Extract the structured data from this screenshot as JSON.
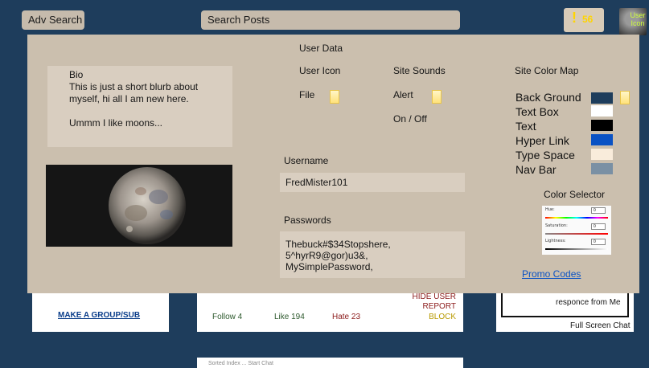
{
  "nav": {
    "adv_search": "Adv Search",
    "search_posts": "Search Posts",
    "alert_mark": "!",
    "alert_count": "56",
    "avatar_text_1": "User",
    "avatar_text_2": "Icon"
  },
  "background": {
    "make_group": "MAKE A GROUP/SUB",
    "follow": "Follow 4",
    "like": "Like 194",
    "hate": "Hate 23",
    "hide_user": "HIDE USER",
    "report": "REPORT",
    "block": "BLOCK",
    "chat_text": "responce from Me",
    "full_screen_chat": "Full Screen Chat",
    "bottom_card_text": "Sorted Index ... Start Chat"
  },
  "panel": {
    "user_data": "User Data",
    "user_icon": "User Icon",
    "file": "File",
    "site_sounds": "Site Sounds",
    "alert": "Alert",
    "on_off": "On / Off",
    "bio": {
      "title": "Bio",
      "line1": "This is just a short blurb about",
      "line2": "myself, hi all I am new here.",
      "line3": "Ummm I like moons..."
    },
    "username_label": "Username",
    "username_value": "FredMister101",
    "passwords_label": "Passwords",
    "passwords": [
      "Thebuck#$34Stopshere,",
      "5^hyrR9@gor)u3&,",
      "MySimplePassword,"
    ],
    "site_color_map": "Site Color Map",
    "colors": [
      {
        "label": "Back Ground",
        "hex": "#1e3d5c"
      },
      {
        "label": "Text Box",
        "hex": "#ffffff"
      },
      {
        "label": "Text",
        "hex": "#000000"
      },
      {
        "label": "Hyper Link",
        "hex": "#0a52c4"
      },
      {
        "label": "Type Space",
        "hex": "#f9ecdb"
      },
      {
        "label": "Nav Bar",
        "hex": "#7a90a4"
      }
    ],
    "color_selector": {
      "title": "Color Selector",
      "hue": "Hue:",
      "saturation": "Saturation:",
      "lightness": "Lightness:",
      "hue_val": "0",
      "sat_val": "0",
      "light_val": "0"
    },
    "promo_codes": "Promo Codes"
  },
  "icons": {
    "file_icon": "file-icon",
    "avatar": "moon-avatar"
  }
}
